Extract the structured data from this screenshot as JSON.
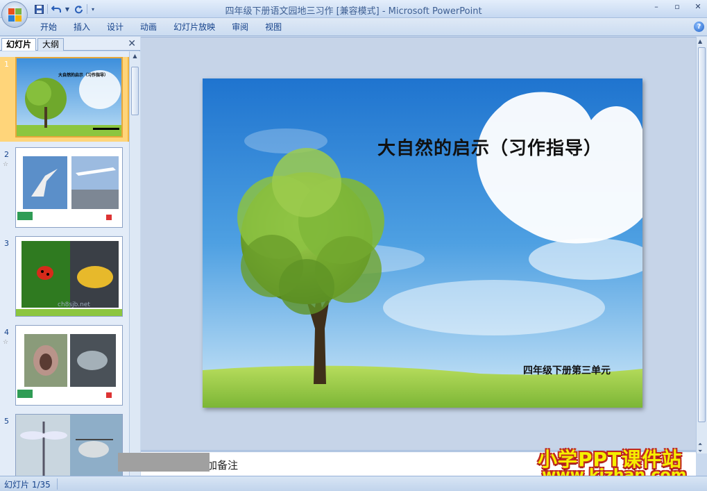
{
  "window": {
    "title": "四年级下册语文园地三习作 [兼容模式] - Microsoft PowerPoint",
    "controls": [
      "–",
      "▫",
      "✕"
    ]
  },
  "quick_access": {
    "save_icon": "save-icon",
    "undo_icon": "undo-icon",
    "redo_icon": "redo-icon"
  },
  "ribbon": {
    "tabs": [
      "开始",
      "插入",
      "设计",
      "动画",
      "幻灯片放映",
      "审阅",
      "视图"
    ],
    "help": "?"
  },
  "left_pane": {
    "tab_slides": "幻灯片",
    "tab_outline": "大纲",
    "close": "✕",
    "slides": [
      {
        "num": "1",
        "selected": true,
        "title": "大自然的启示（习作指导）",
        "subtitle": "四年级下册第三单元"
      },
      {
        "num": "2",
        "star": "☆"
      },
      {
        "num": "3"
      },
      {
        "num": "4",
        "star": "☆"
      },
      {
        "num": "5"
      }
    ],
    "thumb_watermark": "ch8sjb.net"
  },
  "slide": {
    "title": "大自然的启示（习作指导）",
    "subtitle": "四年级下册第三单元"
  },
  "notes": {
    "placeholder": "加备注"
  },
  "watermark": {
    "line1": "小学PPT课件站",
    "line2": "www.kjzhan.com"
  },
  "status": {
    "slide_info": "幻灯片 1/35"
  },
  "colors": {
    "ribbon": "#dfe9f6",
    "selected_thumb": "#ffd57a",
    "sky": "#2f86d6",
    "grass": "#8cc63f"
  }
}
